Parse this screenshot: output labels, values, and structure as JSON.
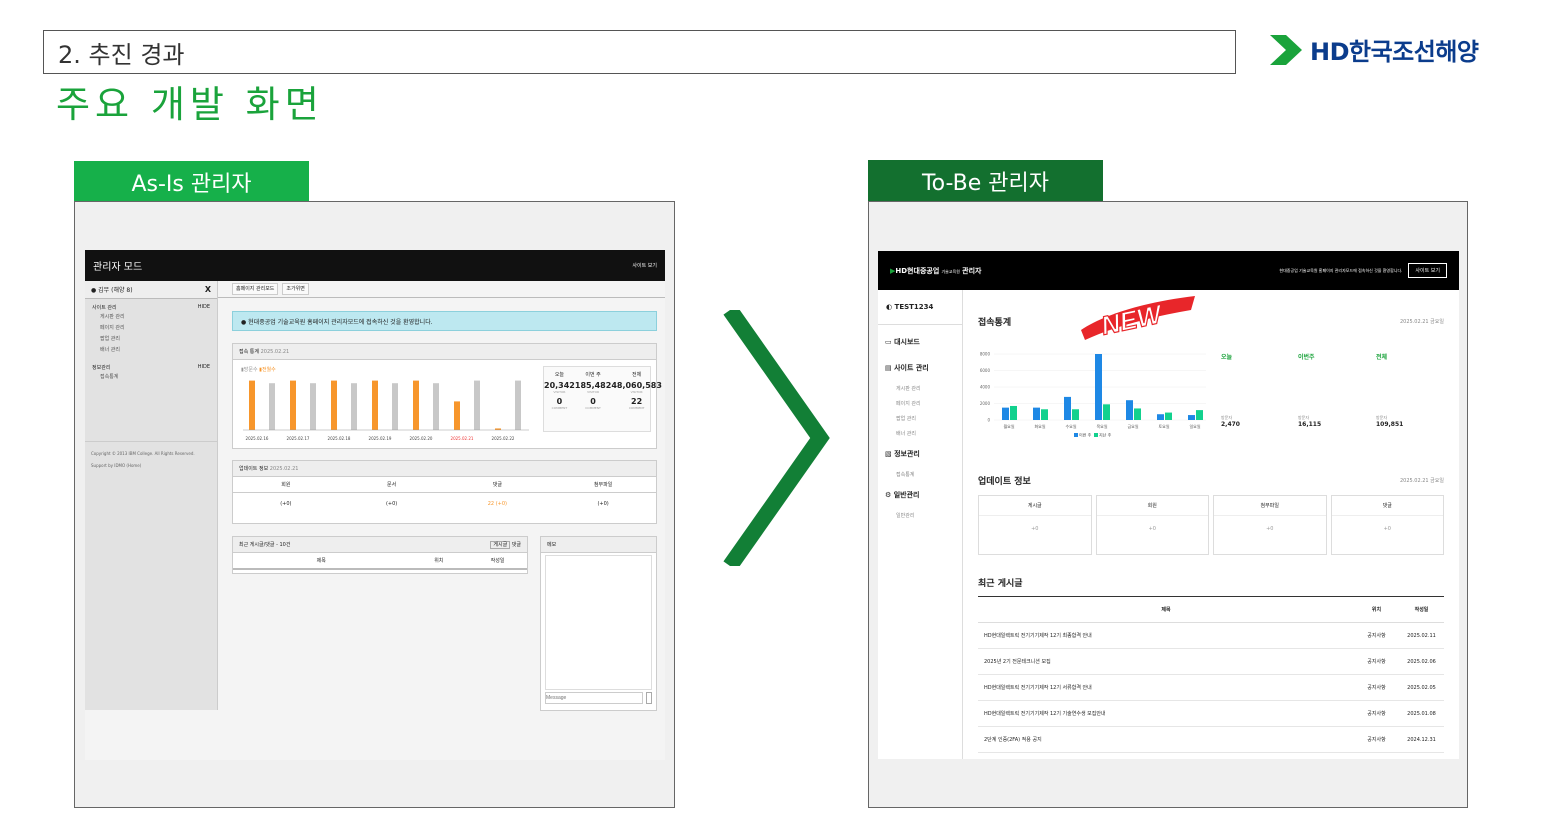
{
  "header": {
    "section": "2. 추진 경과",
    "title": "주요 개발 화면",
    "logo": {
      "icon": "hd-logo-icon",
      "text": "HD한국조선해양",
      "color": "#0b3c8c"
    }
  },
  "tabs": {
    "asis": "As-Is 관리자",
    "tobe": "To-Be 관리자"
  },
  "asis": {
    "top_title": "관리자 모드",
    "top_link": "사이트 보기",
    "user": "김무 (해양 8)",
    "close": "X",
    "groups": [
      {
        "label": "사이트 관리",
        "toggle": "HIDE",
        "items": [
          "게시판 관리",
          "페이지 관리",
          "팝업 관리",
          "배너 관리"
        ]
      },
      {
        "label": "정보관리",
        "toggle": "HIDE",
        "items": [
          "접속통계"
        ]
      }
    ],
    "footer1": "Copyright © 2013 IBM College. All Rights Reserved.",
    "footer2": "Support by IDMO (Home)",
    "tabs": [
      "홈페이지 관리모드",
      "조가위면"
    ],
    "alert": "현대중공업 기술교육원 홈페이지 관리자모드에 접속하신 것을 환영합니다.",
    "stats_title": "접속 통계",
    "stats_date": "2025.02.21",
    "legend": [
      "방문수",
      "전월수"
    ],
    "stat_heads": [
      "오늘",
      "이번 주",
      "전체"
    ],
    "stat_vals": [
      "20,342",
      "185,482",
      "48,060,583"
    ],
    "stat_sub": "VISITOR",
    "comment_vals": [
      "0",
      "0",
      "22"
    ],
    "comment_sub": "COMMENT",
    "dates": [
      "2025.02.16",
      "2025.02.17",
      "2025.02.18",
      "2025.02.19",
      "2025.02.20",
      "2025.02.21",
      "2025.02.22"
    ],
    "update_title": "업데이트 정보",
    "update_date": "2025.02.21",
    "update_cols": [
      "회원",
      "문서",
      "댓글",
      "첨부파일"
    ],
    "update_vals": [
      "(+0)",
      "(+0)",
      "22 (+0)",
      "(+0)"
    ],
    "recent_title": "최근 게시글/댓글 - 10건",
    "recent_tabs": [
      "게시글",
      "댓글"
    ],
    "recent_cols": [
      "제목",
      "위치",
      "작성일"
    ],
    "memo_title": "메모",
    "message_placeholder": "Message"
  },
  "tobe": {
    "brand": "HD현대중공업",
    "brand_sub": "기술교육원",
    "brand_admin": "관리자",
    "welcome": "현대중공업 기술교육원 홈페이지 관리자모드에 접속하신 것을 환영합니다.",
    "site_btn": "사이트 보기",
    "user": "TEST1234",
    "menus": [
      {
        "label": "대시보드",
        "items": []
      },
      {
        "label": "사이트 관리",
        "items": [
          "게시판 관리",
          "페이지 관리",
          "팝업 관리",
          "배너 관리"
        ]
      },
      {
        "label": "정보관리",
        "items": [
          "접속통계"
        ]
      },
      {
        "label": "일반관리",
        "items": [
          "일반관리"
        ]
      }
    ],
    "stats_title": "접속통계",
    "stats_date": "2025.02.21 금요일",
    "chart_days": [
      "월요일",
      "화요일",
      "수요일",
      "목요일",
      "금요일",
      "토요일",
      "일요일"
    ],
    "chart_legend": [
      "이번 주",
      "지난 주"
    ],
    "stat_cols": [
      {
        "label": "오늘",
        "total_label": "방문자",
        "total": "2,470"
      },
      {
        "label": "이번주",
        "total_label": "방문자",
        "total": "16,115"
      },
      {
        "label": "전체",
        "total_label": "방문자",
        "total": "109,851"
      }
    ],
    "update_title": "업데이트 정보",
    "update_date": "2025.02.21 금요일",
    "update_cols": [
      "게시글",
      "회원",
      "첨부파일",
      "댓글"
    ],
    "update_vals": [
      "+0",
      "+0",
      "+0",
      "+0"
    ],
    "recent_title": "최근 게시글",
    "recent_cols": [
      "제목",
      "위치",
      "작성일"
    ],
    "recent_rows": [
      {
        "title": "HD현대일렉트릭 전기기기제작 12기 최종합격 안내",
        "loc": "공지사항",
        "date": "2025.02.11"
      },
      {
        "title": "2025년 2기 전문테크니션 모집",
        "loc": "공지사항",
        "date": "2025.02.06"
      },
      {
        "title": "HD현대일렉트릭 전기기기제작 12기 서류합격 안내",
        "loc": "공지사항",
        "date": "2025.02.05"
      },
      {
        "title": "HD현대일렉트릭 전기기기제작 12기 기술연수생 모집안내",
        "loc": "공지사항",
        "date": "2025.01.08"
      },
      {
        "title": "2단계 인증(2FA) 적용 공지",
        "loc": "공지사항",
        "date": "2024.12.31"
      }
    ],
    "badge": "NEW"
  },
  "chart_data": [
    {
      "type": "bar",
      "categories": [
        "2025.02.16",
        "2025.02.17",
        "2025.02.18",
        "2025.02.19",
        "2025.02.20",
        "2025.02.21",
        "2025.02.22"
      ],
      "series": [
        {
          "name": "방문수",
          "color": "#f7962b",
          "values": [
            0.95,
            0.95,
            0.95,
            0.95,
            0.95,
            0.55,
            0.03
          ]
        },
        {
          "name": "전월수",
          "color": "#c8c8c8",
          "values": [
            0.9,
            0.9,
            0.9,
            0.9,
            0.9,
            0.95,
            0.95
          ]
        }
      ]
    },
    {
      "type": "bar",
      "categories": [
        "월요일",
        "화요일",
        "수요일",
        "목요일",
        "금요일",
        "토요일",
        "일요일"
      ],
      "ylim": [
        0,
        8000
      ],
      "series": [
        {
          "name": "이번 주",
          "color": "#1e88e5",
          "values": [
            1500,
            1500,
            2800,
            8000,
            2400,
            700,
            600
          ]
        },
        {
          "name": "지난 주",
          "color": "#12d18e",
          "values": [
            1700,
            1300,
            1300,
            1900,
            1400,
            900,
            1200
          ]
        }
      ]
    }
  ]
}
